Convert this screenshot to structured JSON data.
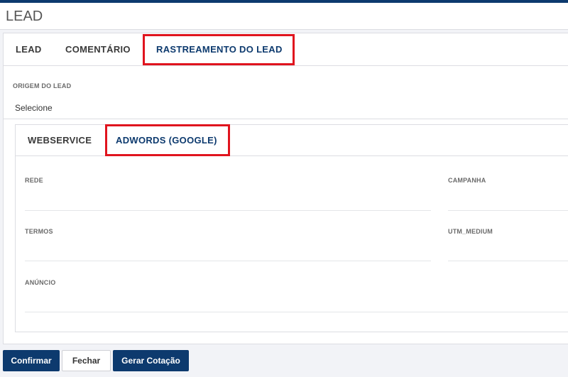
{
  "page": {
    "title": "LEAD"
  },
  "main_tabs": [
    {
      "label": "LEAD",
      "active": false
    },
    {
      "label": "COMENTÁRIO",
      "active": false
    },
    {
      "label": "RASTREAMENTO DO LEAD",
      "active": true
    }
  ],
  "origin": {
    "label": "ORIGEM DO LEAD",
    "value": "Selecione"
  },
  "sub_tabs": [
    {
      "label": "WEBSERVICE",
      "active": false
    },
    {
      "label": "ADWORDS (GOOGLE)",
      "active": true
    }
  ],
  "fields": {
    "rede": {
      "label": "REDE",
      "value": ""
    },
    "campanha": {
      "label": "CAMPANHA",
      "value": ""
    },
    "termos": {
      "label": "TERMOS",
      "value": ""
    },
    "utm_medium": {
      "label": "UTM_MEDIUM",
      "value": ""
    },
    "anuncio": {
      "label": "ANÚNCIO",
      "value": ""
    }
  },
  "buttons": {
    "confirm": "Confirmar",
    "close": "Fechar",
    "quote": "Gerar Cotação"
  },
  "colors": {
    "primary": "#0d3a6e",
    "highlight": "#e0141e"
  }
}
